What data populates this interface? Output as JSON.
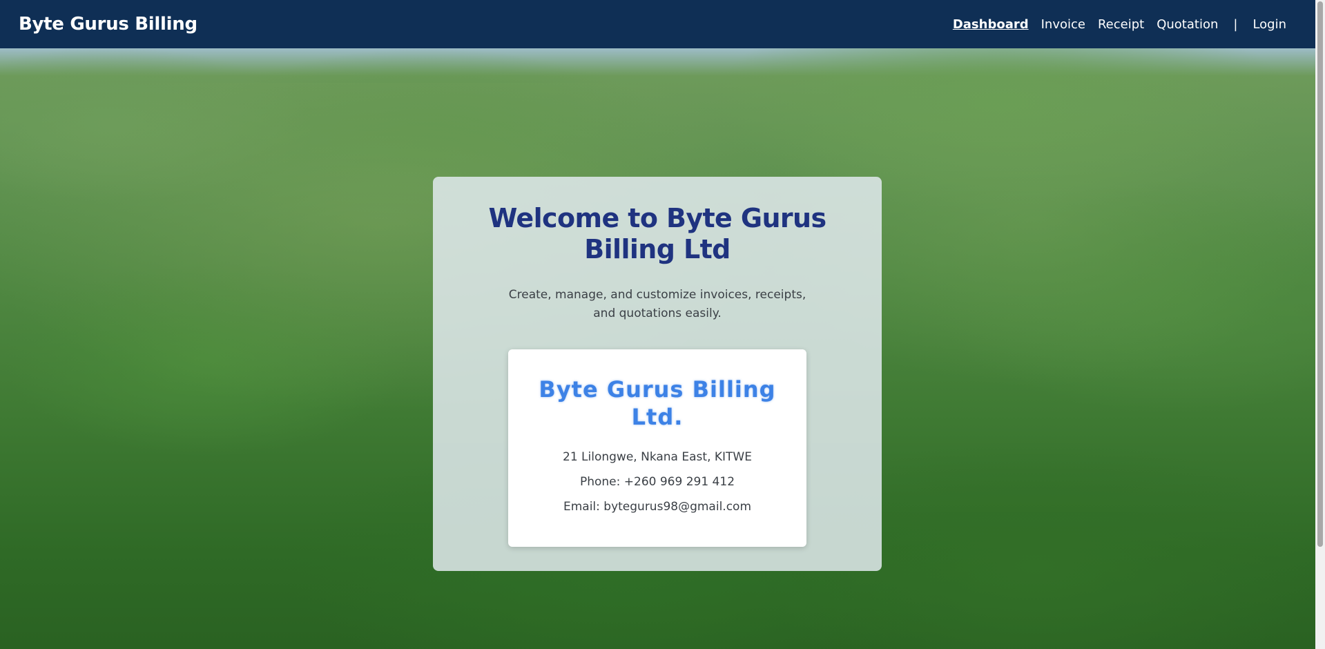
{
  "navbar": {
    "brand": "Byte Gurus Billing",
    "links": [
      {
        "label": "Dashboard",
        "active": true
      },
      {
        "label": "Invoice",
        "active": false
      },
      {
        "label": "Receipt",
        "active": false
      },
      {
        "label": "Quotation",
        "active": false
      }
    ],
    "separator": "|",
    "login_label": "Login"
  },
  "welcome": {
    "title": "Welcome to Byte Gurus Billing Ltd",
    "tagline": "Create, manage, and customize invoices, receipts, and quotations easily."
  },
  "company": {
    "name": "Byte Gurus Billing Ltd.",
    "address": "21 Lilongwe, Nkana East, KITWE",
    "phone": "Phone: +260 969 291 412",
    "email": "Email: bytegurus98@gmail.com"
  },
  "colors": {
    "navbar_bg": "#0f2f55",
    "title": "#1f3380",
    "company_name": "#3d82e6"
  }
}
